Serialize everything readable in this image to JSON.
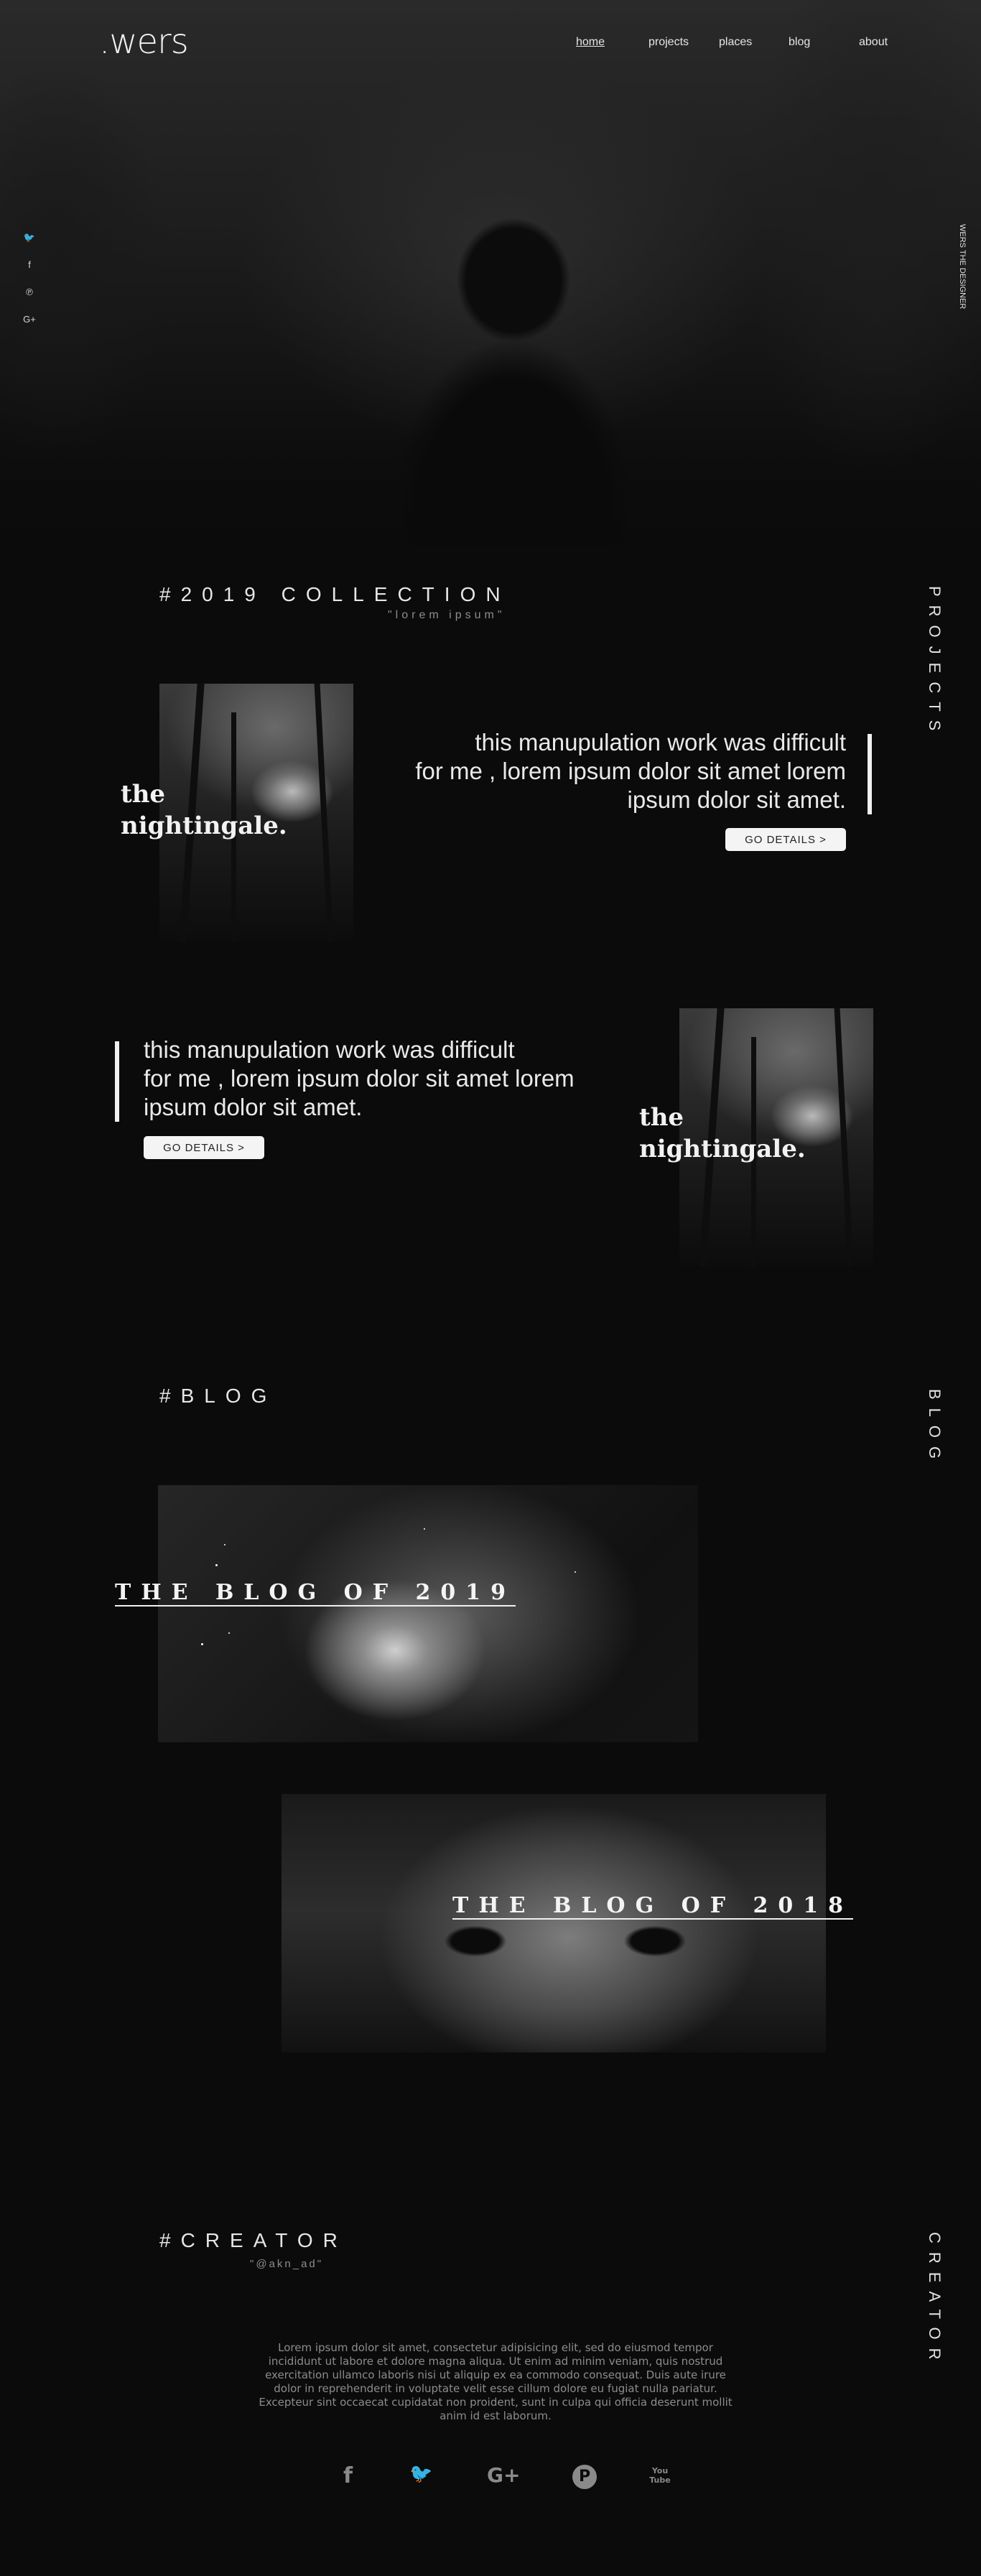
{
  "header": {
    "logo": ".wers",
    "nav": [
      "home",
      "projects",
      "places",
      "blog",
      "about"
    ],
    "side_social_icons": [
      "twitter-icon",
      "facebook-icon",
      "pinterest-icon",
      "google-plus-icon"
    ],
    "side_tag": "WERS THE DESIGNER"
  },
  "projects": {
    "heading": "#2019 COLLECTION",
    "subheading": "\"lorem ipsum\"",
    "side_tag": "PROJECTS",
    "items": [
      {
        "title_line1": "the",
        "title_line2": "nightingale.",
        "text_line1": "this manupulation work was difficult",
        "text_line2": "for me , lorem ipsum dolor sit amet lorem",
        "text_line3": "ipsum dolor sit amet.",
        "button": "GO DETAILS >"
      },
      {
        "title_line1": "the",
        "title_line2": "nightingale.",
        "text_line1": "this manupulation work was difficult",
        "text_line2": "for me , lorem ipsum dolor sit amet lorem",
        "text_line3": "ipsum dolor sit amet.",
        "button": "GO DETAILS >"
      }
    ]
  },
  "blog": {
    "heading": "#BLOG",
    "side_tag": "BLOG",
    "posts": [
      {
        "title": "THE BLOG OF 2019"
      },
      {
        "title": "THE BLOG OF 2018"
      }
    ]
  },
  "creator": {
    "heading": "#CREATOR",
    "subheading": "\"@akn_ad\"",
    "side_tag": "CREATOR",
    "text": "Lorem ipsum dolor sit amet, consectetur adipisicing elit, sed do eiusmod tempor incididunt ut labore et dolore magna aliqua. Ut enim ad minim veniam, quis nostrud exercitation ullamco laboris nisi ut aliquip ex ea commodo consequat. Duis aute irure dolor in reprehenderit in voluptate velit esse cillum dolore eu fugiat nulla pariatur. Excepteur sint occaecat cupidatat non proident, sunt in culpa qui officia deserunt mollit anim id est laborum.",
    "social_icons": [
      "facebook-icon",
      "twitter-icon",
      "google-plus-icon",
      "pinterest-icon",
      "youtube-icon"
    ],
    "social_glyphs": [
      "f",
      "🐦",
      "G+",
      "P",
      "You Tube"
    ]
  }
}
